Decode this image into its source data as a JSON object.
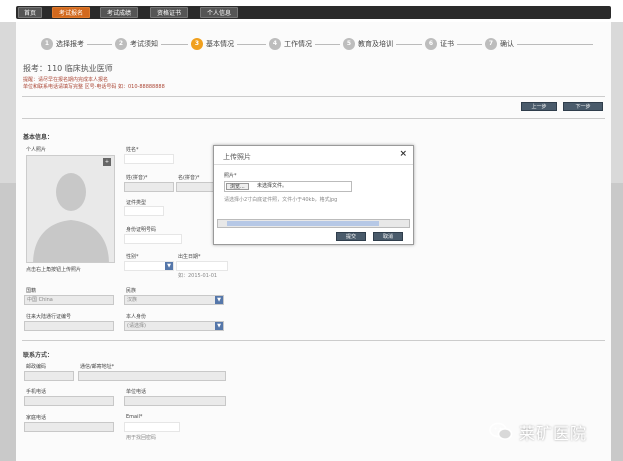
{
  "nav": {
    "tabs": [
      {
        "label": "首页",
        "active": false
      },
      {
        "label": "考试报名",
        "active": true
      },
      {
        "label": "考试成绩",
        "active": false
      },
      {
        "label": "资格证书",
        "active": false
      },
      {
        "label": "个人信息",
        "active": false
      }
    ]
  },
  "stepper": {
    "steps": [
      {
        "num": "1",
        "label": "选择报考",
        "active": false
      },
      {
        "num": "2",
        "label": "考试须知",
        "active": false
      },
      {
        "num": "3",
        "label": "基本情况",
        "active": true
      },
      {
        "num": "4",
        "label": "工作情况",
        "active": false
      },
      {
        "num": "5",
        "label": "教育及培训",
        "active": false
      },
      {
        "num": "6",
        "label": "证书",
        "active": false
      },
      {
        "num": "7",
        "label": "确认",
        "active": false
      }
    ]
  },
  "header": {
    "title": "报考：110 临床执业医师",
    "note1": "提醒：请尽早在报名期内完成本人报名",
    "note2": "单位和联系电话请填写完整 区号-电话号码 如：010-88888888"
  },
  "actions": {
    "prev": "上一步",
    "next": "下一步"
  },
  "form": {
    "section_basic": "基本信息：",
    "photo_label": "个人照片",
    "photo_hint": "点击右上角按钮上传照片",
    "photo_badge": "+",
    "name_label": "姓名*",
    "surname_label": "姓(拼音)*",
    "given_label": "名(拼音)*",
    "id_type_label": "证件类型",
    "id_num_label": "身份证明号码",
    "gender_label": "性别*",
    "birth_label": "出生日期*",
    "birth_hint": "如：2015-01-01",
    "nation_label": "国籍",
    "nation_value": "中国 China",
    "ethnic_label": "民族",
    "ethnic_value": "汉族",
    "passport_label": "往来大陆通行证编号",
    "identity_label": "本人身份",
    "identity_value": "(请选择)",
    "section_contact": "联系方式：",
    "zip_label": "邮政编码",
    "addr_label": "通信/邮寄地址*",
    "mobile_label": "手机电话",
    "work_phone_label": "单位电话",
    "home_phone_label": "家庭电话",
    "email_label": "Email*",
    "email_hint": "用于找回密码"
  },
  "modal": {
    "title": "上传照片",
    "close": "×",
    "photo_label": "照片*",
    "browse": "浏览...",
    "no_file": "未选择文件。",
    "hint": "请选择小2寸白底证件照，文件小于40kb，格式jpg",
    "submit": "提交",
    "cancel": "取消"
  },
  "watermark": {
    "text": "莱矿医院"
  },
  "colors": {
    "accent": "#d2691e",
    "step_active": "#f0a01e",
    "button": "#4a5b6b",
    "select": "#5577aa"
  }
}
